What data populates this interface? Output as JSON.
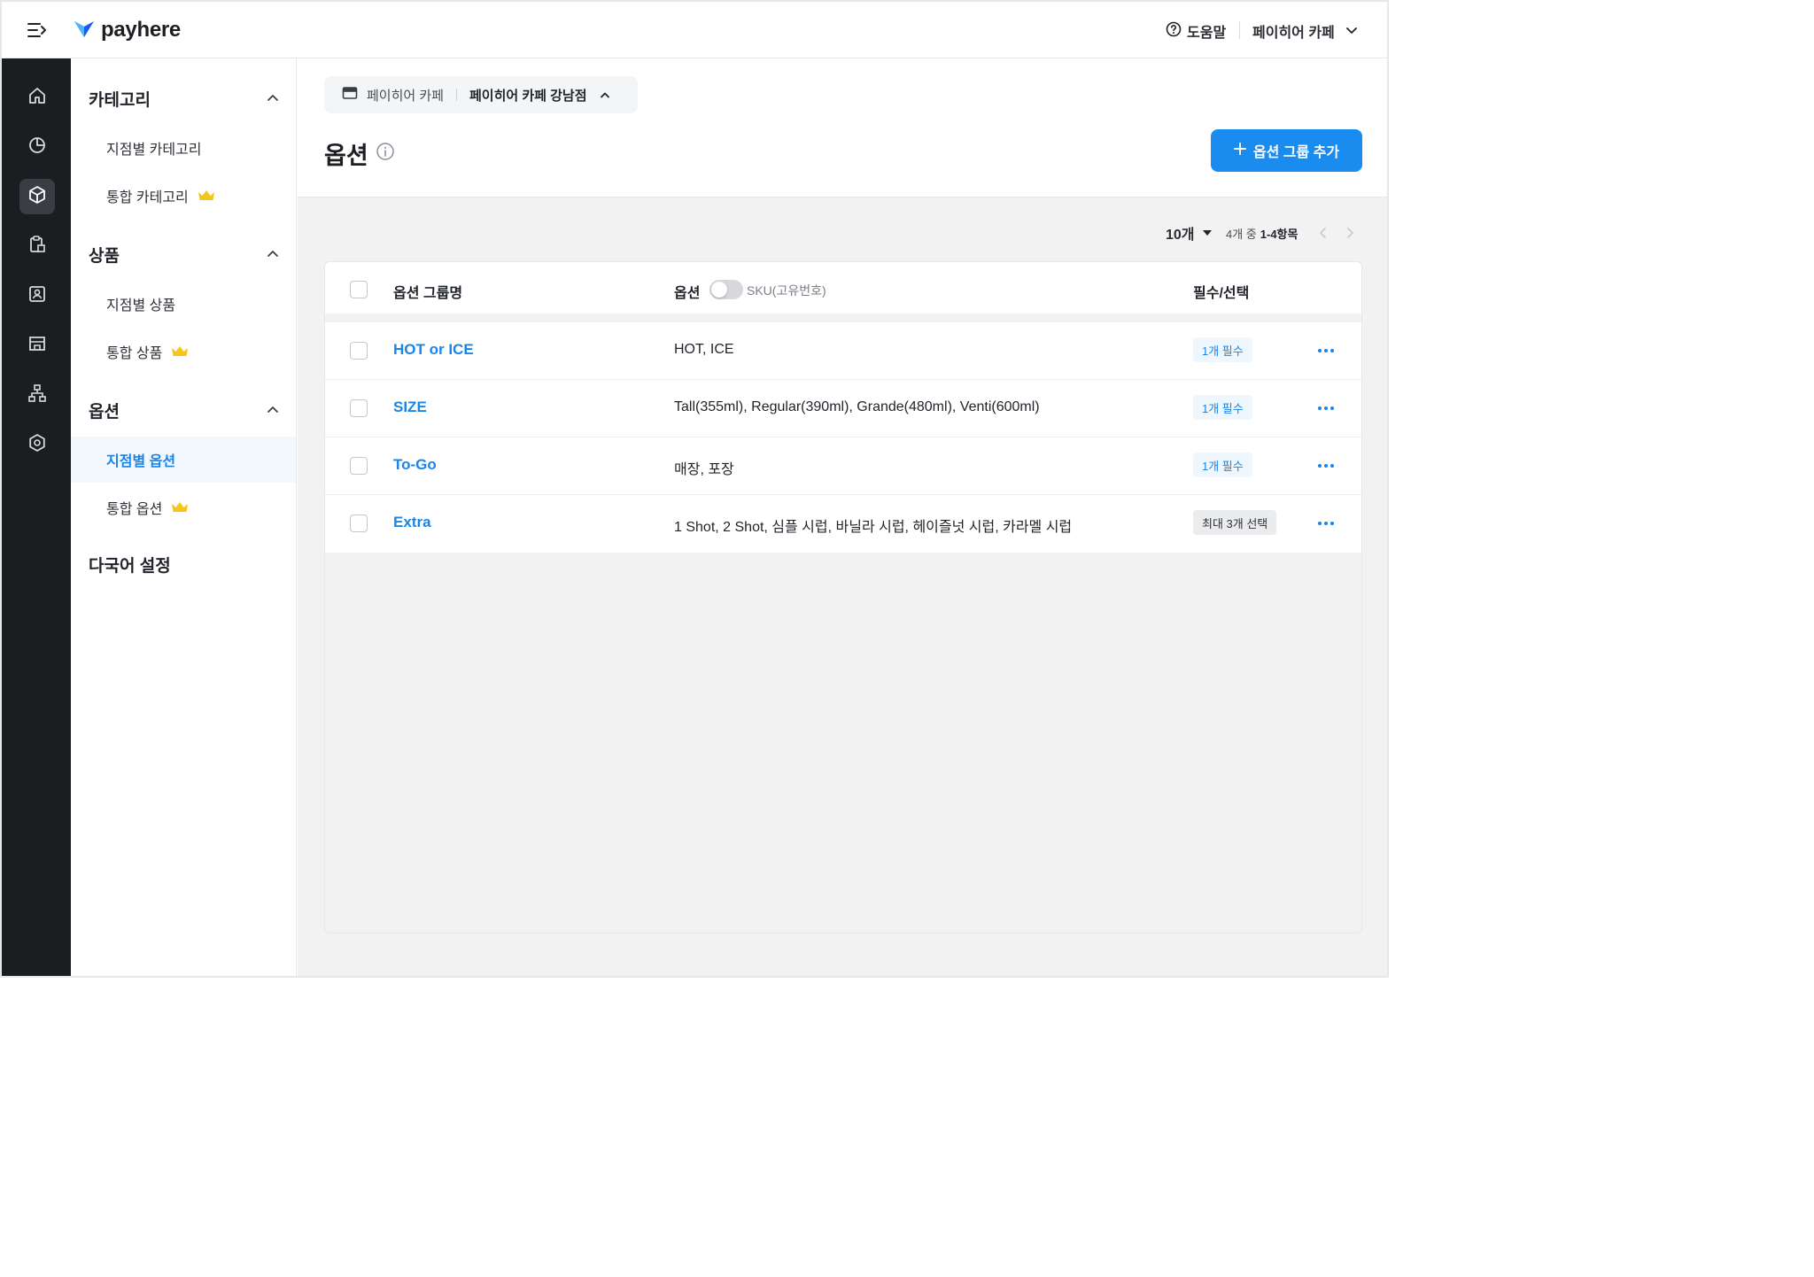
{
  "header": {
    "brand": "payhere",
    "help_label": "도움말",
    "store_name": "페이히어 카페"
  },
  "sidebar": {
    "sections": [
      {
        "title": "카테고리",
        "items": [
          {
            "label": "지점별 카테고리",
            "premium": false
          },
          {
            "label": "통합 카테고리",
            "premium": true
          }
        ]
      },
      {
        "title": "상품",
        "items": [
          {
            "label": "지점별 상품",
            "premium": false
          },
          {
            "label": "통합 상품",
            "premium": true
          }
        ]
      },
      {
        "title": "옵션",
        "items": [
          {
            "label": "지점별 옵션",
            "premium": false,
            "active": true
          },
          {
            "label": "통합 옵션",
            "premium": true
          }
        ]
      }
    ],
    "language_settings": "다국어 설정"
  },
  "main": {
    "store_crumb": {
      "base": "페이히어 카페",
      "current": "페이히어 카페 강남점"
    },
    "title": "옵션",
    "add_button": "옵션 그룹 추가",
    "pager": {
      "page_size": "10개",
      "count_prefix": "4개 중",
      "range": "1-4항목"
    },
    "table": {
      "columns": {
        "group_name": "옵션 그룹명",
        "options": "옵션",
        "sku_toggle_label": "SKU(고유번호)",
        "required": "필수/선택"
      },
      "rows": [
        {
          "name": "HOT or ICE",
          "options": "HOT, ICE",
          "badge": "1개 필수",
          "badge_type": "required"
        },
        {
          "name": "SIZE",
          "options": "Tall(355ml), Regular(390ml), Grande(480ml), Venti(600ml)",
          "badge": "1개 필수",
          "badge_type": "required"
        },
        {
          "name": "To-Go",
          "options": "매장, 포장",
          "badge": "1개 필수",
          "badge_type": "required"
        },
        {
          "name": "Extra",
          "options": "1 Shot, 2 Shot, 심플 시럽, 바닐라 시럽, 헤이즐넛 시럽, 카라멜 시럽",
          "badge": "최대 3개 선택",
          "badge_type": "optional"
        }
      ]
    }
  },
  "colors": {
    "accent": "#1a8cf0",
    "rail": "#1b1d21",
    "premium": "#f5c518"
  },
  "icons": {
    "rail": [
      "home-icon",
      "chart-icon",
      "box-icon",
      "clipboard-icon",
      "contact-icon",
      "store-icon",
      "org-icon",
      "gear-icon"
    ]
  }
}
